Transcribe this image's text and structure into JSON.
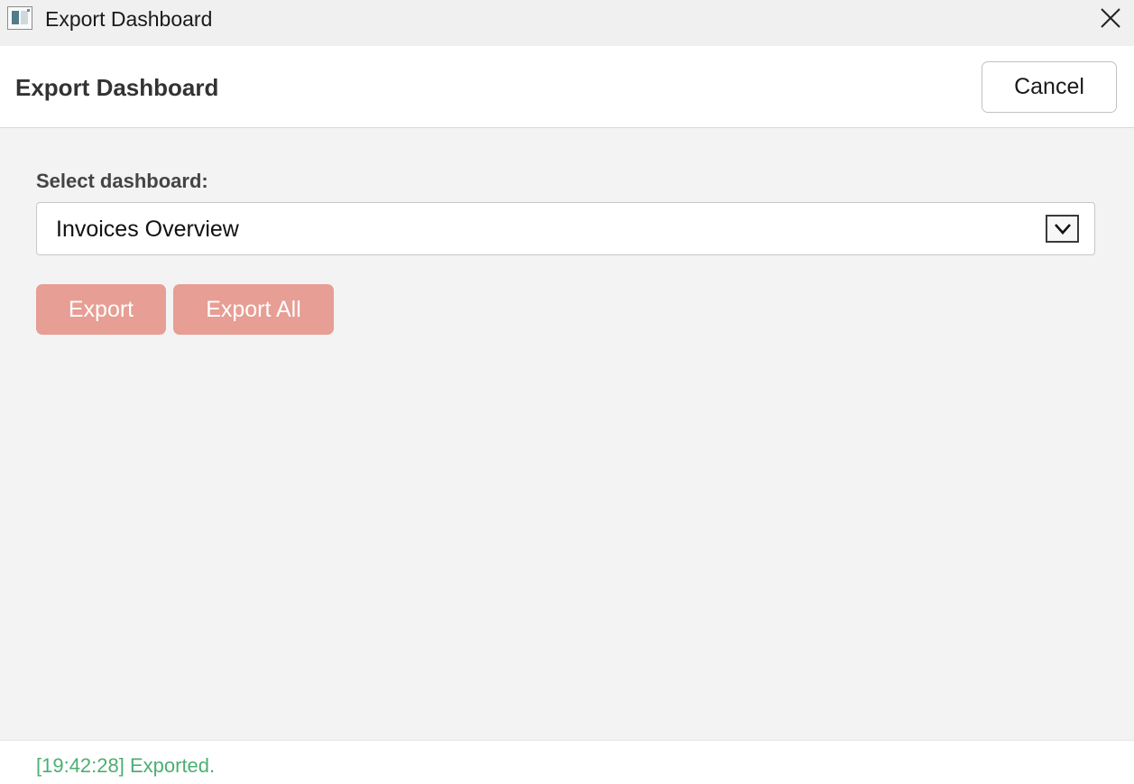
{
  "window": {
    "title": "Export Dashboard",
    "icon": "app-window-icon",
    "close_icon": "close-icon"
  },
  "header": {
    "title": "Export Dashboard",
    "cancel_label": "Cancel"
  },
  "form": {
    "select_label": "Select dashboard:",
    "select_value": "Invoices Overview",
    "dropdown_icon": "chevron-down-icon"
  },
  "actions": {
    "export_label": "Export",
    "export_all_label": "Export All",
    "button_color": "#e79a8f"
  },
  "status": {
    "message": "[19:42:28] Exported.",
    "color": "#4caf72"
  }
}
